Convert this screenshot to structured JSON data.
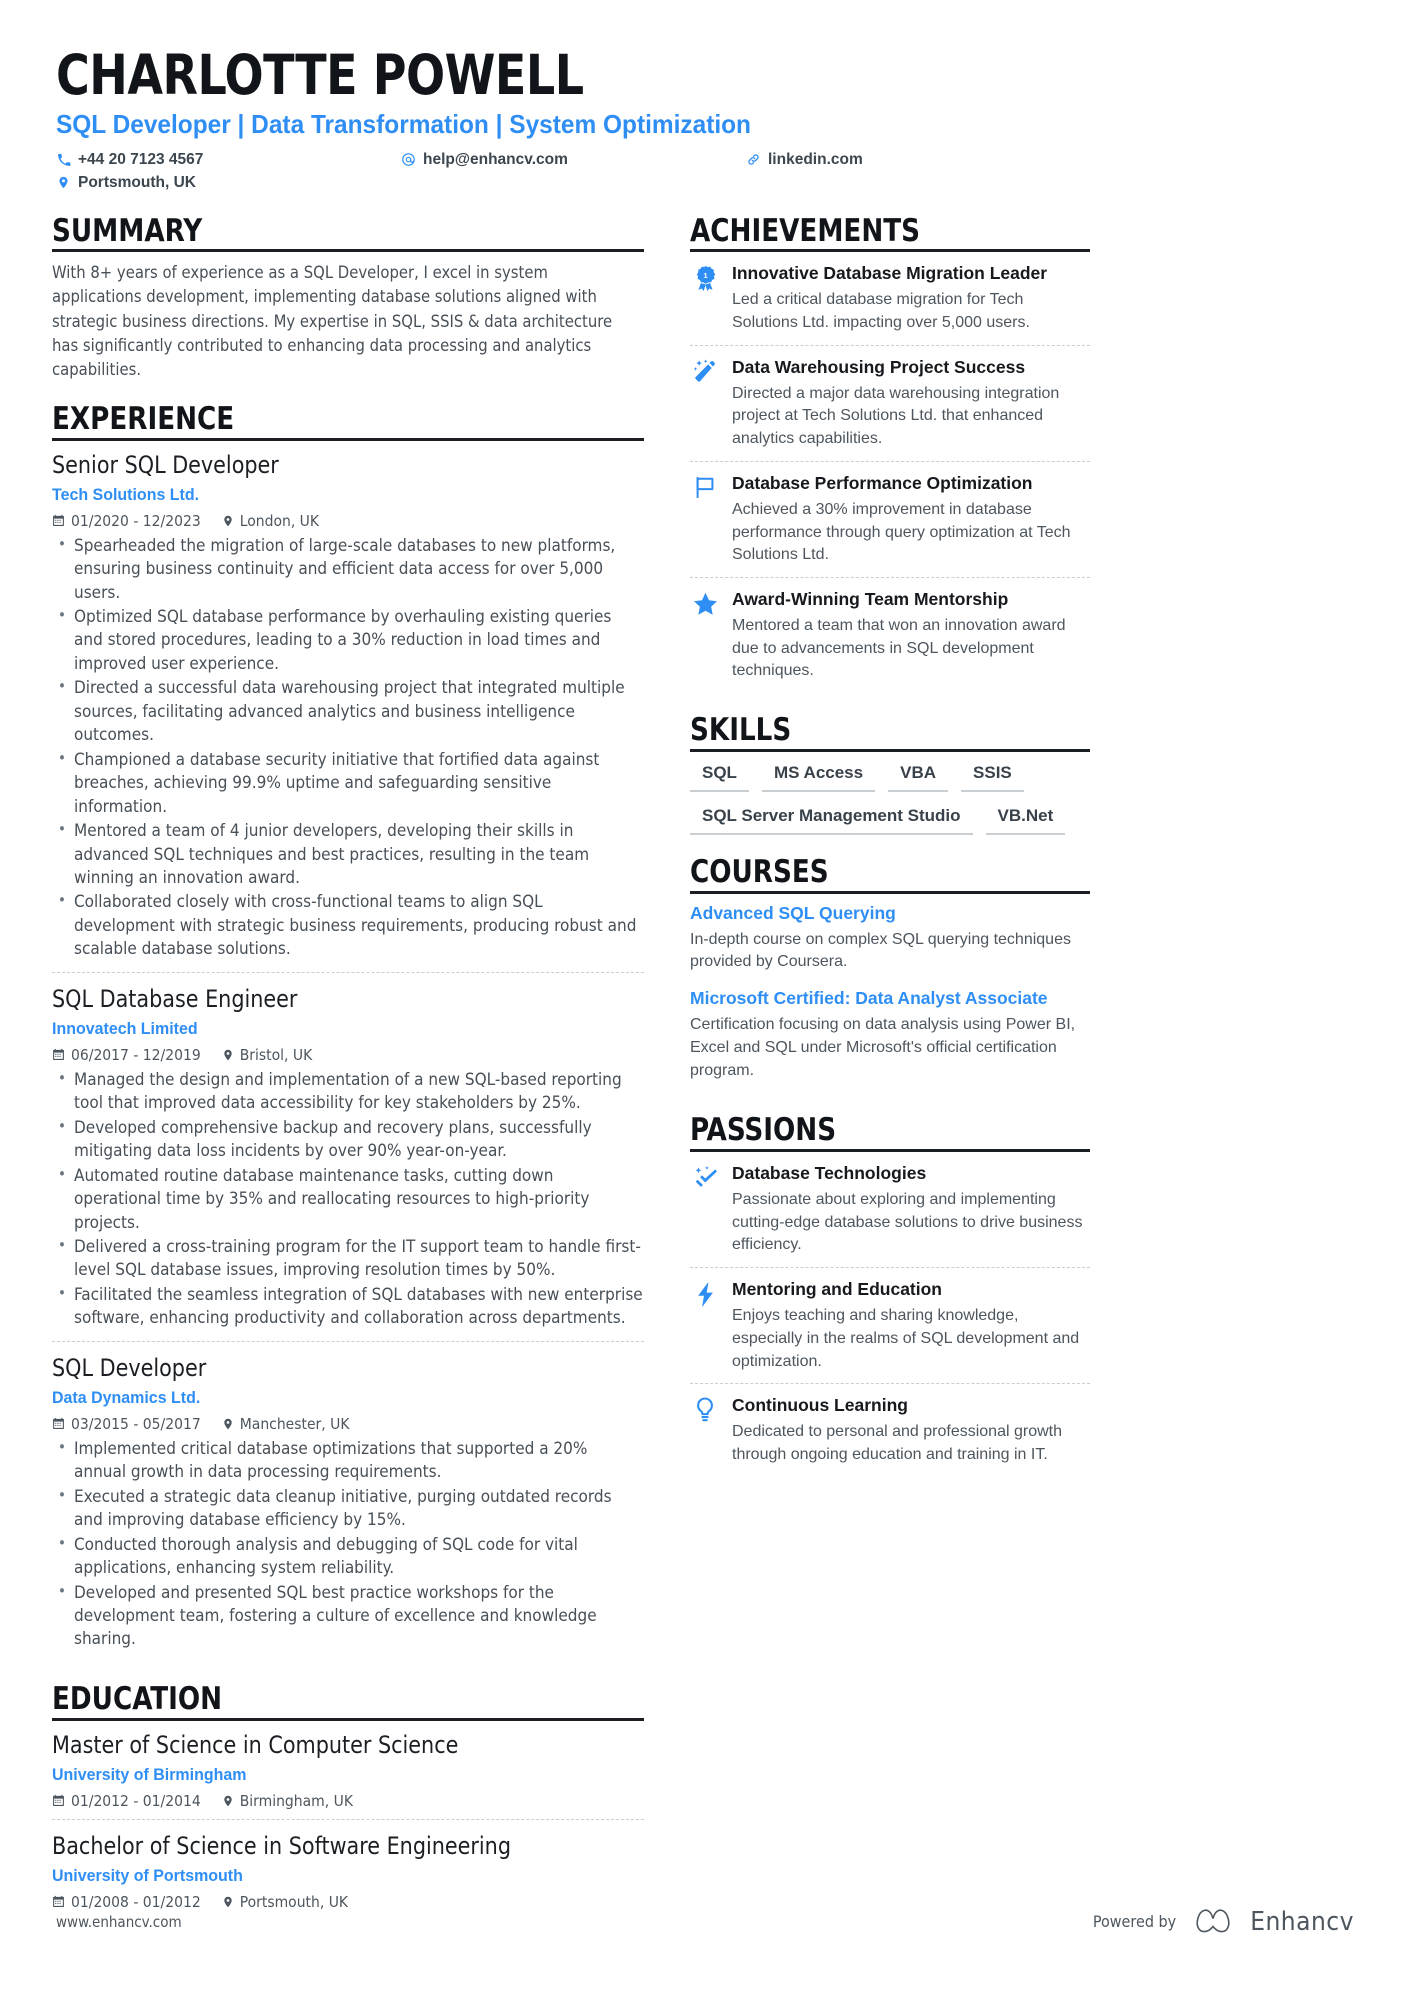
{
  "header": {
    "name": "CHARLOTTE POWELL",
    "headline": "SQL Developer | Data Transformation | System Optimization",
    "contacts": [
      {
        "icon": "phone-icon",
        "text": "+44 20 7123 4567"
      },
      {
        "icon": "email-icon",
        "text": "help@enhancv.com"
      },
      {
        "icon": "link-icon",
        "text": "linkedin.com"
      },
      {
        "icon": "location-pin-icon",
        "text": "Portsmouth, UK"
      }
    ]
  },
  "summary": {
    "title": "SUMMARY",
    "text": "With 8+ years of experience as a SQL Developer, I excel in system applications development, implementing database solutions aligned with strategic business directions. My expertise in SQL, SSIS & data architecture has significantly contributed to enhancing data processing and analytics capabilities."
  },
  "experience": {
    "title": "EXPERIENCE",
    "jobs": [
      {
        "role": "Senior SQL Developer",
        "company": "Tech Solutions Ltd.",
        "dates": "01/2020 - 12/2023",
        "location": "London, UK",
        "bullets": [
          "Spearheaded the migration of large-scale databases to new platforms, ensuring business continuity and efficient data access for over 5,000 users.",
          "Optimized SQL database performance by overhauling existing queries and stored procedures, leading to a 30% reduction in load times and improved user experience.",
          "Directed a successful data warehousing project that integrated multiple sources, facilitating advanced analytics and business intelligence outcomes.",
          "Championed a database security initiative that fortified data against breaches, achieving 99.9% uptime and safeguarding sensitive information.",
          "Mentored a team of 4 junior developers, developing their skills in advanced SQL techniques and best practices, resulting in the team winning an innovation award.",
          "Collaborated closely with cross-functional teams to align SQL development with strategic business requirements, producing robust and scalable database solutions."
        ]
      },
      {
        "role": "SQL Database Engineer",
        "company": "Innovatech Limited",
        "dates": "06/2017 - 12/2019",
        "location": "Bristol, UK",
        "bullets": [
          "Managed the design and implementation of a new SQL-based reporting tool that improved data accessibility for key stakeholders by 25%.",
          "Developed comprehensive backup and recovery plans, successfully mitigating data loss incidents by over 90% year-on-year.",
          "Automated routine database maintenance tasks, cutting down operational time by 35% and reallocating resources to high-priority projects.",
          "Delivered a cross-training program for the IT support team to handle first-level SQL database issues, improving resolution times by 50%.",
          "Facilitated the seamless integration of SQL databases with new enterprise software, enhancing productivity and collaboration across departments."
        ]
      },
      {
        "role": "SQL Developer",
        "company": "Data Dynamics Ltd.",
        "dates": "03/2015 - 05/2017",
        "location": "Manchester, UK",
        "bullets": [
          "Implemented critical database optimizations that supported a 20% annual growth in data processing requirements.",
          "Executed a strategic data cleanup initiative, purging outdated records and improving database efficiency by 15%.",
          "Conducted thorough analysis and debugging of SQL code for vital applications, enhancing system reliability.",
          "Developed and presented SQL best practice workshops for the development team, fostering a culture of excellence and knowledge sharing."
        ]
      }
    ]
  },
  "education": {
    "title": "EDUCATION",
    "entries": [
      {
        "degree": "Master of Science in Computer Science",
        "school": "University of Birmingham",
        "dates": "01/2012 - 01/2014",
        "location": "Birmingham, UK"
      },
      {
        "degree": "Bachelor of Science in Software Engineering",
        "school": "University of Portsmouth",
        "dates": "01/2008 - 01/2012",
        "location": "Portsmouth, UK"
      }
    ]
  },
  "achievements": {
    "title": "ACHIEVEMENTS",
    "items": [
      {
        "icon": "award-ribbon-icon",
        "title": "Innovative Database Migration Leader",
        "desc": "Led a critical database migration for Tech Solutions Ltd. impacting over 5,000 users."
      },
      {
        "icon": "magic-wand-icon",
        "title": "Data Warehousing Project Success",
        "desc": "Directed a major data warehousing integration project at Tech Solutions Ltd. that enhanced analytics capabilities."
      },
      {
        "icon": "flag-icon",
        "title": "Database Performance Optimization",
        "desc": "Achieved a 30% improvement in database performance through query optimization at Tech Solutions Ltd."
      },
      {
        "icon": "star-icon",
        "title": "Award-Winning Team Mentorship",
        "desc": "Mentored a team that won an innovation award due to advancements in SQL development techniques."
      }
    ]
  },
  "skills": {
    "title": "SKILLS",
    "rows": [
      [
        "SQL",
        "MS Access",
        "VBA",
        "SSIS"
      ],
      [
        "SQL Server Management Studio",
        "VB.Net"
      ]
    ]
  },
  "courses": {
    "title": "COURSES",
    "items": [
      {
        "title": "Advanced SQL Querying",
        "desc": "In-depth course on complex SQL querying techniques provided by Coursera."
      },
      {
        "title": "Microsoft Certified: Data Analyst Associate",
        "desc": "Certification focusing on data analysis using Power BI, Excel and SQL under Microsoft's official certification program."
      }
    ]
  },
  "passions": {
    "title": "PASSIONS",
    "items": [
      {
        "icon": "sparkle-arrow-icon",
        "title": "Database Technologies",
        "desc": "Passionate about exploring and implementing cutting-edge database solutions to drive business efficiency."
      },
      {
        "icon": "lightning-bolt-icon",
        "title": "Mentoring and Education",
        "desc": "Enjoys teaching and sharing knowledge, especially in the realms of SQL development and optimization."
      },
      {
        "icon": "lightbulb-icon",
        "title": "Continuous Learning",
        "desc": "Dedicated to personal and professional growth through ongoing education and training in IT."
      }
    ]
  },
  "footer": {
    "url": "www.enhancv.com",
    "powered_by": "Powered by",
    "brand": "Enhancv"
  },
  "colors": {
    "accent": "#2f8ef4",
    "heading": "#111418",
    "body": "#474f57"
  }
}
